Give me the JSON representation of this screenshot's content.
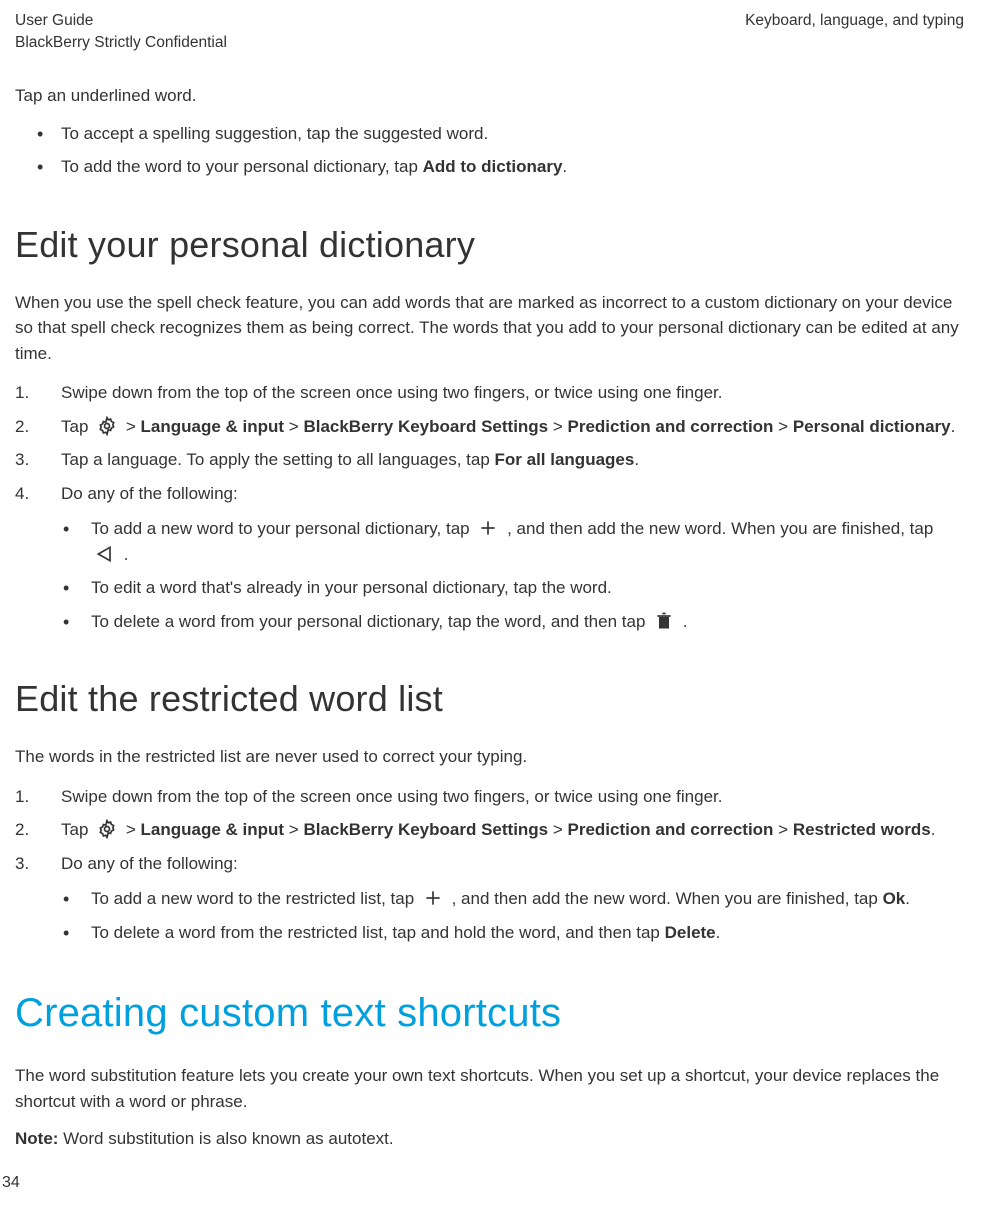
{
  "header": {
    "left_line1": "User Guide",
    "left_line2": "BlackBerry Strictly Confidential",
    "right_line1": "Keyboard, language, and typing"
  },
  "intro": {
    "tap_underlined": "Tap an underlined word.",
    "bullet1_prefix": "To accept a spelling suggestion, tap the suggested word.",
    "bullet2_prefix": "To add the word to your personal dictionary, tap ",
    "bullet2_bold": "Add to dictionary",
    "bullet2_suffix": "."
  },
  "section1": {
    "title": "Edit your personal dictionary",
    "desc": "When you use the spell check feature, you can add words that are marked as incorrect to a custom dictionary on your device so that spell check recognizes them as being correct. The words that you add to your personal dictionary can be edited at any time.",
    "step1": "Swipe down from the top of the screen once using two fingers, or twice using one finger.",
    "step2_tap": "Tap ",
    "step2_gt1": " > ",
    "step2_b1": "Language & input",
    "step2_gt2": " > ",
    "step2_b2": "BlackBerry Keyboard Settings",
    "step2_gt3": " > ",
    "step2_b3": "Prediction and correction",
    "step2_gt4": " > ",
    "step2_b4": "Personal dictionary",
    "step2_end": ".",
    "step3_prefix": "Tap a language. To apply the setting to all languages, tap ",
    "step3_bold": "For all languages",
    "step3_suffix": ".",
    "step4": "Do any of the following:",
    "sub1_a": "To add a new word to your personal dictionary, tap ",
    "sub1_b": " , and then add the new word. When you are finished, tap ",
    "sub1_c": " .",
    "sub2": " To edit a word that's already in your personal dictionary, tap the word.",
    "sub3_a": "To delete a word from your personal dictionary, tap the word, and then tap ",
    "sub3_b": " ."
  },
  "section2": {
    "title": "Edit the restricted word list",
    "desc": "The words in the restricted list are never used to correct your typing.",
    "step1": "Swipe down from the top of the screen once using two fingers, or twice using one finger.",
    "step2_tap": "Tap ",
    "step2_gt1": " > ",
    "step2_b1": "Language & input",
    "step2_gt2": " > ",
    "step2_b2": "BlackBerry Keyboard Settings",
    "step2_gt3": " > ",
    "step2_b3": "Prediction and correction",
    "step2_gt4": " > ",
    "step2_b4": "Restricted words",
    "step2_end": ".",
    "step3": "Do any of the following:",
    "sub1_a": "To add a new word to the restricted list, tap ",
    "sub1_b": " , and then add the new word. When you are finished, tap ",
    "sub1_bold": "Ok",
    "sub1_c": ".",
    "sub2_a": " To delete a word from the restricted list, tap and hold the word, and then tap ",
    "sub2_bold": "Delete",
    "sub2_b": "."
  },
  "section3": {
    "title": "Creating custom text shortcuts",
    "desc": "The word substitution feature lets you create your own text shortcuts. When you set up a shortcut, your device replaces the shortcut with a word or phrase.",
    "note_label": "Note:",
    "note_text": " Word substitution is also known as autotext."
  },
  "pageNumber": "34"
}
